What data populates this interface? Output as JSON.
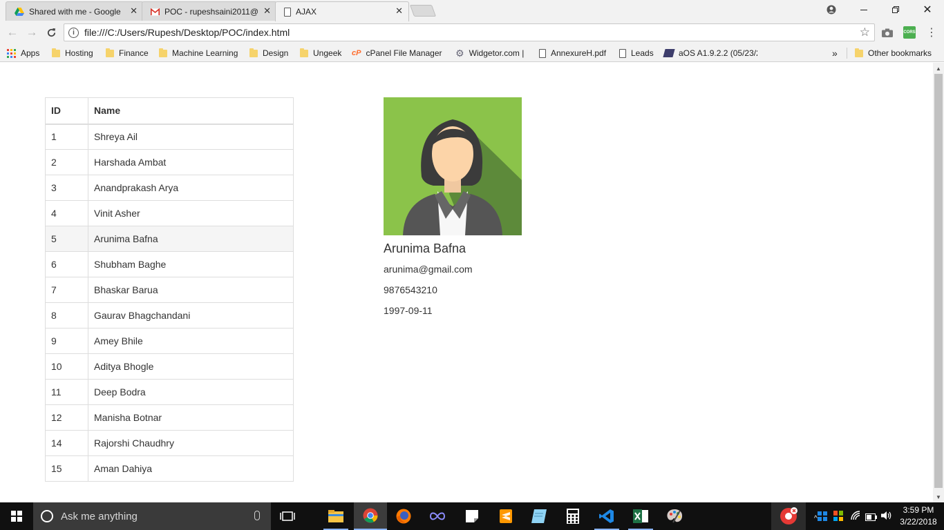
{
  "browser": {
    "tabs": [
      {
        "title": "Shared with me - Google",
        "icon": "google-drive-icon",
        "active": false
      },
      {
        "title": "POC - rupeshsaini2011@",
        "icon": "gmail-icon",
        "active": false
      },
      {
        "title": "AJAX",
        "icon": "page-icon",
        "active": true
      }
    ],
    "url": "file:///C:/Users/Rupesh/Desktop/POC/index.html",
    "extension_label": "CORS",
    "bookmarks": [
      {
        "label": "Apps",
        "icon": "apps-grid-icon"
      },
      {
        "label": "Hosting",
        "icon": "folder-icon"
      },
      {
        "label": "Finance",
        "icon": "folder-icon"
      },
      {
        "label": "Machine Learning",
        "icon": "folder-icon"
      },
      {
        "label": "Design",
        "icon": "folder-icon"
      },
      {
        "label": "Ungeek",
        "icon": "folder-icon"
      },
      {
        "label": "cPanel File Manager v",
        "icon": "cpanel-icon"
      },
      {
        "label": "Widgetor.com |",
        "icon": "gear-icon"
      },
      {
        "label": "AnnexureH.pdf",
        "icon": "page-icon"
      },
      {
        "label": "Leads",
        "icon": "page-icon"
      },
      {
        "label": "aOS A1.9.2.2 (05/23/2",
        "icon": "aos-icon"
      }
    ],
    "overflow_label": "»",
    "other_bookmarks": "Other bookmarks"
  },
  "table": {
    "headers": {
      "id": "ID",
      "name": "Name"
    },
    "rows": [
      {
        "id": "1",
        "name": "Shreya Ail"
      },
      {
        "id": "2",
        "name": "Harshada Ambat"
      },
      {
        "id": "3",
        "name": "Anandprakash Arya"
      },
      {
        "id": "4",
        "name": "Vinit Asher"
      },
      {
        "id": "5",
        "name": "Arunima Bafna"
      },
      {
        "id": "6",
        "name": "Shubham Baghe"
      },
      {
        "id": "7",
        "name": "Bhaskar Barua"
      },
      {
        "id": "8",
        "name": "Gaurav Bhagchandani"
      },
      {
        "id": "9",
        "name": "Amey Bhile"
      },
      {
        "id": "10",
        "name": "Aditya Bhogle"
      },
      {
        "id": "11",
        "name": "Deep Bodra"
      },
      {
        "id": "12",
        "name": "Manisha Botnar"
      },
      {
        "id": "14",
        "name": "Rajorshi Chaudhry"
      },
      {
        "id": "15",
        "name": "Aman Dahiya"
      }
    ],
    "hovered_id": "5"
  },
  "profile": {
    "name": "Arunima Bafna",
    "email": "arunima@gmail.com",
    "phone": "9876543210",
    "dob": "1997-09-11",
    "avatar_icon": "female-avatar-icon"
  },
  "taskbar": {
    "search_placeholder": "Ask me anything",
    "time": "3:59 PM",
    "date": "3/22/2018"
  },
  "colors": {
    "avatar_bg": "#8bc34a",
    "avatar_shadow": "#5d8a3a",
    "taskbar": "#101010",
    "accent": "#8ab4f8"
  }
}
